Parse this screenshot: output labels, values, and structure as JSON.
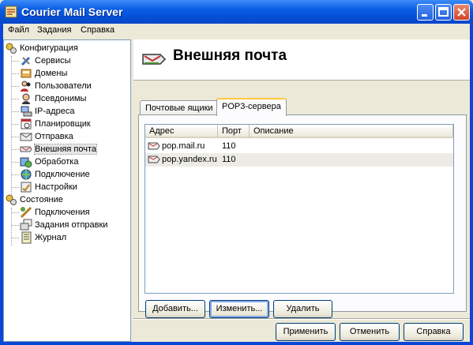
{
  "window": {
    "title": "Courier Mail Server",
    "accent": "#0a46d7"
  },
  "menu": [
    "Файл",
    "Задания",
    "Справка"
  ],
  "tree": {
    "config": {
      "label": "Конфигурация",
      "items": [
        "Сервисы",
        "Домены",
        "Пользователи",
        "Псевдонимы",
        "IP-адреса",
        "Планировщик",
        "Отправка",
        "Внешняя почта",
        "Обработка",
        "Подключение",
        "Настройки"
      ]
    },
    "state": {
      "label": "Состояние",
      "items": [
        "Подключения",
        "Задания отправки",
        "Журнал"
      ]
    },
    "selected": "Внешняя почта"
  },
  "page": {
    "title": "Внешняя почта"
  },
  "tabs": [
    "Почтовые ящики",
    "POP3-сервера"
  ],
  "active_tab": "POP3-сервера",
  "columns": [
    "Адрес",
    "Порт",
    "Описание"
  ],
  "rows": [
    {
      "address": "pop.mail.ru",
      "port": "110",
      "desc": ""
    },
    {
      "address": "pop.yandex.ru",
      "port": "110",
      "desc": ""
    }
  ],
  "list_buttons": {
    "add": "Добавить...",
    "edit": "Изменить...",
    "delete": "Удалить"
  },
  "dialog_buttons": {
    "apply": "Применить",
    "cancel": "Отменить",
    "help": "Справка"
  }
}
